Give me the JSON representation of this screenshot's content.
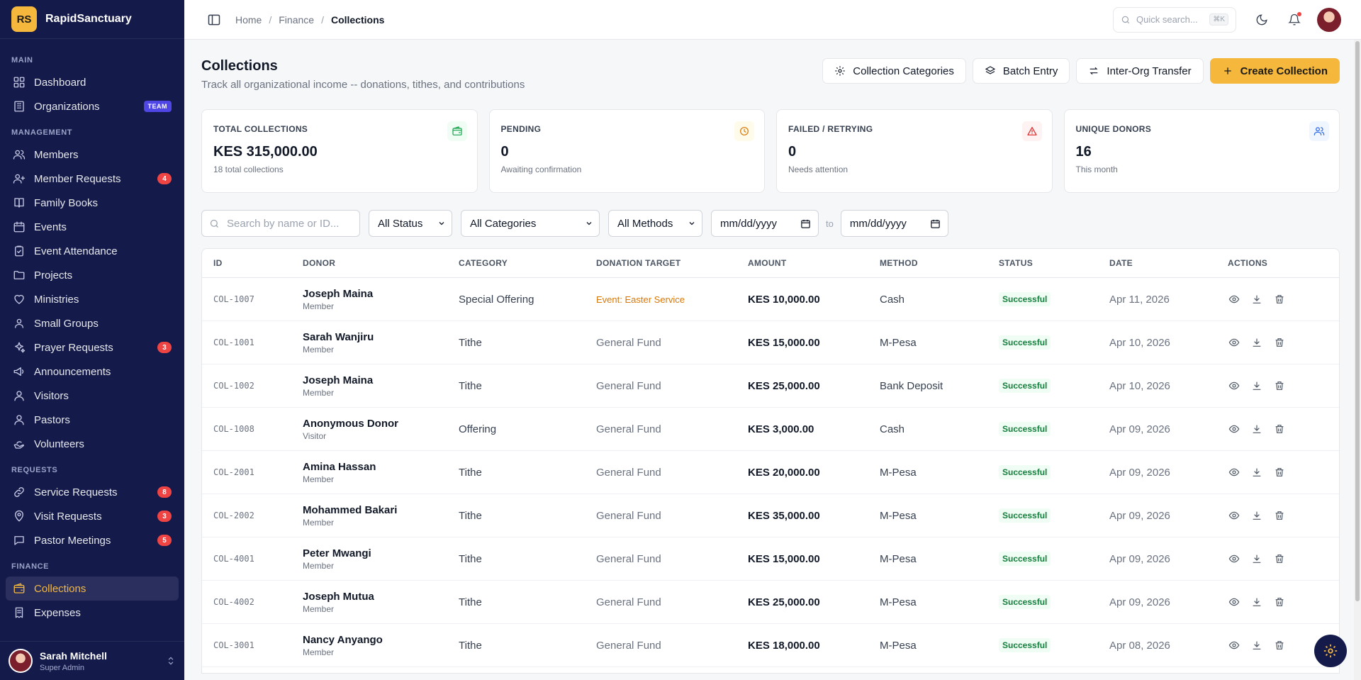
{
  "brand": {
    "logo": "RS",
    "name": "RapidSanctuary"
  },
  "sidebar": {
    "sections": [
      {
        "title": "MAIN",
        "items": [
          {
            "label": "Dashboard",
            "icon": "grid-icon"
          },
          {
            "label": "Organizations",
            "icon": "building-icon",
            "tag": "TEAM"
          }
        ]
      },
      {
        "title": "MANAGEMENT",
        "items": [
          {
            "label": "Members",
            "icon": "users-icon"
          },
          {
            "label": "Member Requests",
            "icon": "user-plus-icon",
            "count": "4"
          },
          {
            "label": "Family Books",
            "icon": "book-icon"
          },
          {
            "label": "Events",
            "icon": "calendar-icon"
          },
          {
            "label": "Event Attendance",
            "icon": "clipboard-check-icon"
          },
          {
            "label": "Projects",
            "icon": "folder-icon"
          },
          {
            "label": "Ministries",
            "icon": "heart-icon"
          },
          {
            "label": "Small Groups",
            "icon": "user-group-icon"
          },
          {
            "label": "Prayer Requests",
            "icon": "sparkles-icon",
            "count": "3"
          },
          {
            "label": "Announcements",
            "icon": "megaphone-icon"
          },
          {
            "label": "Visitors",
            "icon": "user-icon"
          },
          {
            "label": "Pastors",
            "icon": "user-icon"
          },
          {
            "label": "Volunteers",
            "icon": "hand-icon"
          }
        ]
      },
      {
        "title": "REQUESTS",
        "items": [
          {
            "label": "Service Requests",
            "icon": "link-icon",
            "count": "8"
          },
          {
            "label": "Visit Requests",
            "icon": "map-pin-icon",
            "count": "3"
          },
          {
            "label": "Pastor Meetings",
            "icon": "chat-icon",
            "count": "5"
          }
        ]
      },
      {
        "title": "FINANCE",
        "items": [
          {
            "label": "Collections",
            "icon": "wallet-icon",
            "active": true
          },
          {
            "label": "Expenses",
            "icon": "receipt-icon"
          }
        ]
      }
    ]
  },
  "user": {
    "name": "Sarah Mitchell",
    "role": "Super Admin"
  },
  "topbar": {
    "breadcrumb": [
      "Home",
      "Finance",
      "Collections"
    ],
    "search_placeholder": "Quick search...",
    "search_shortcut": "⌘K"
  },
  "page": {
    "title": "Collections",
    "subtitle": "Track all organizational income -- donations, tithes, and contributions",
    "actions": {
      "categories": "Collection Categories",
      "batch": "Batch Entry",
      "transfer": "Inter-Org Transfer",
      "create": "Create Collection"
    }
  },
  "stats": [
    {
      "label": "TOTAL COLLECTIONS",
      "value": "KES 315,000.00",
      "sub": "18 total collections",
      "icon": "wallet-icon",
      "color": "#16a34a",
      "bg": "#f0fdf4"
    },
    {
      "label": "PENDING",
      "value": "0",
      "sub": "Awaiting confirmation",
      "icon": "clock-icon",
      "color": "#d97706",
      "bg": "#fffbeb"
    },
    {
      "label": "FAILED / RETRYING",
      "value": "0",
      "sub": "Needs attention",
      "icon": "alert-triangle-icon",
      "color": "#dc2626",
      "bg": "#fef2f2"
    },
    {
      "label": "UNIQUE DONORS",
      "value": "16",
      "sub": "This month",
      "icon": "users-icon",
      "color": "#2563eb",
      "bg": "#eff6ff"
    }
  ],
  "filters": {
    "search_placeholder": "Search by name or ID...",
    "status": "All Status",
    "category": "All Categories",
    "method": "All Methods",
    "date_from": "mm/dd/yyyy",
    "to_label": "to",
    "date_to": "mm/dd/yyyy"
  },
  "table": {
    "headers": [
      "ID",
      "DONOR",
      "CATEGORY",
      "DONATION TARGET",
      "AMOUNT",
      "METHOD",
      "STATUS",
      "DATE",
      "ACTIONS"
    ],
    "rows": [
      {
        "id": "COL-1007",
        "donor": "Joseph Maina",
        "type": "Member",
        "category": "Special Offering",
        "target": "Event: Easter Service",
        "event": true,
        "amount": "KES 10,000.00",
        "method": "Cash",
        "status": "Successful",
        "date": "Apr 11, 2026"
      },
      {
        "id": "COL-1001",
        "donor": "Sarah Wanjiru",
        "type": "Member",
        "category": "Tithe",
        "target": "General Fund",
        "amount": "KES 15,000.00",
        "method": "M-Pesa",
        "status": "Successful",
        "date": "Apr 10, 2026"
      },
      {
        "id": "COL-1002",
        "donor": "Joseph Maina",
        "type": "Member",
        "category": "Tithe",
        "target": "General Fund",
        "amount": "KES 25,000.00",
        "method": "Bank Deposit",
        "status": "Successful",
        "date": "Apr 10, 2026"
      },
      {
        "id": "COL-1008",
        "donor": "Anonymous Donor",
        "type": "Visitor",
        "category": "Offering",
        "target": "General Fund",
        "amount": "KES 3,000.00",
        "method": "Cash",
        "status": "Successful",
        "date": "Apr 09, 2026"
      },
      {
        "id": "COL-2001",
        "donor": "Amina Hassan",
        "type": "Member",
        "category": "Tithe",
        "target": "General Fund",
        "amount": "KES 20,000.00",
        "method": "M-Pesa",
        "status": "Successful",
        "date": "Apr 09, 2026"
      },
      {
        "id": "COL-2002",
        "donor": "Mohammed Bakari",
        "type": "Member",
        "category": "Tithe",
        "target": "General Fund",
        "amount": "KES 35,000.00",
        "method": "M-Pesa",
        "status": "Successful",
        "date": "Apr 09, 2026"
      },
      {
        "id": "COL-4001",
        "donor": "Peter Mwangi",
        "type": "Member",
        "category": "Tithe",
        "target": "General Fund",
        "amount": "KES 15,000.00",
        "method": "M-Pesa",
        "status": "Successful",
        "date": "Apr 09, 2026"
      },
      {
        "id": "COL-4002",
        "donor": "Joseph Mutua",
        "type": "Member",
        "category": "Tithe",
        "target": "General Fund",
        "amount": "KES 25,000.00",
        "method": "M-Pesa",
        "status": "Successful",
        "date": "Apr 09, 2026"
      },
      {
        "id": "COL-3001",
        "donor": "Nancy Anyango",
        "type": "Member",
        "category": "Tithe",
        "target": "General Fund",
        "amount": "KES 18,000.00",
        "method": "M-Pesa",
        "status": "Successful",
        "date": "Apr 08, 2026"
      }
    ]
  }
}
